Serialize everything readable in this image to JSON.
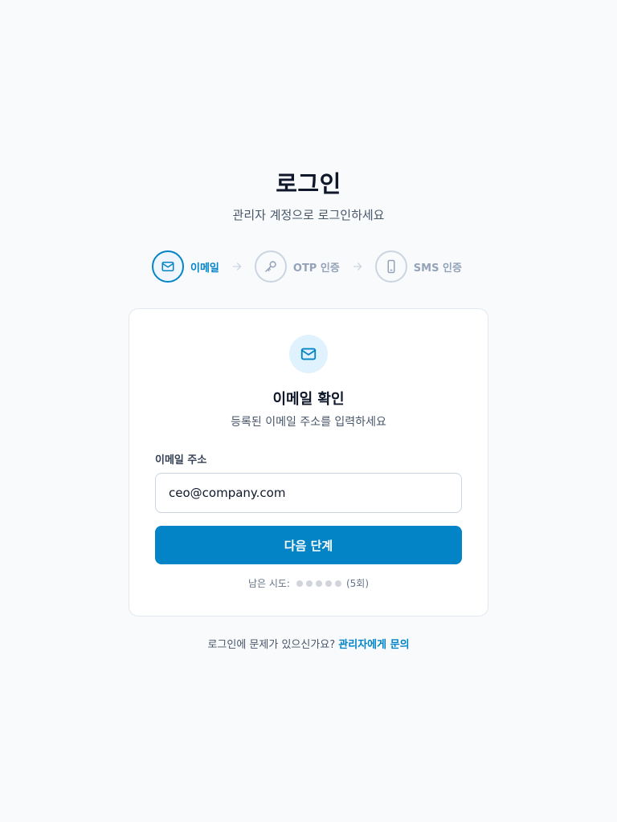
{
  "header": {
    "title": "로그인",
    "subtitle": "관리자 계정으로 로그인하세요"
  },
  "steps": [
    {
      "label": "이메일",
      "icon": "mail-icon",
      "active": true
    },
    {
      "label": "OTP 인증",
      "icon": "key-icon",
      "active": false
    },
    {
      "label": "SMS 인증",
      "icon": "phone-icon",
      "active": false
    }
  ],
  "card": {
    "icon": "mail-icon",
    "title": "이메일 확인",
    "description": "등록된 이메일 주소를 입력하세요",
    "email_label": "이메일 주소",
    "email_value": "ceo@company.com",
    "next_button": "다음 단계",
    "attempts_label": "남은 시도:",
    "attempts_count": "(5회)",
    "attempts_remaining": 5
  },
  "footer": {
    "text": "로그인에 문제가 있으신가요?",
    "link": "관리자에게 문의"
  },
  "colors": {
    "accent": "#0284c7",
    "background": "#f8fafc",
    "inactive": "#94a3b8"
  }
}
